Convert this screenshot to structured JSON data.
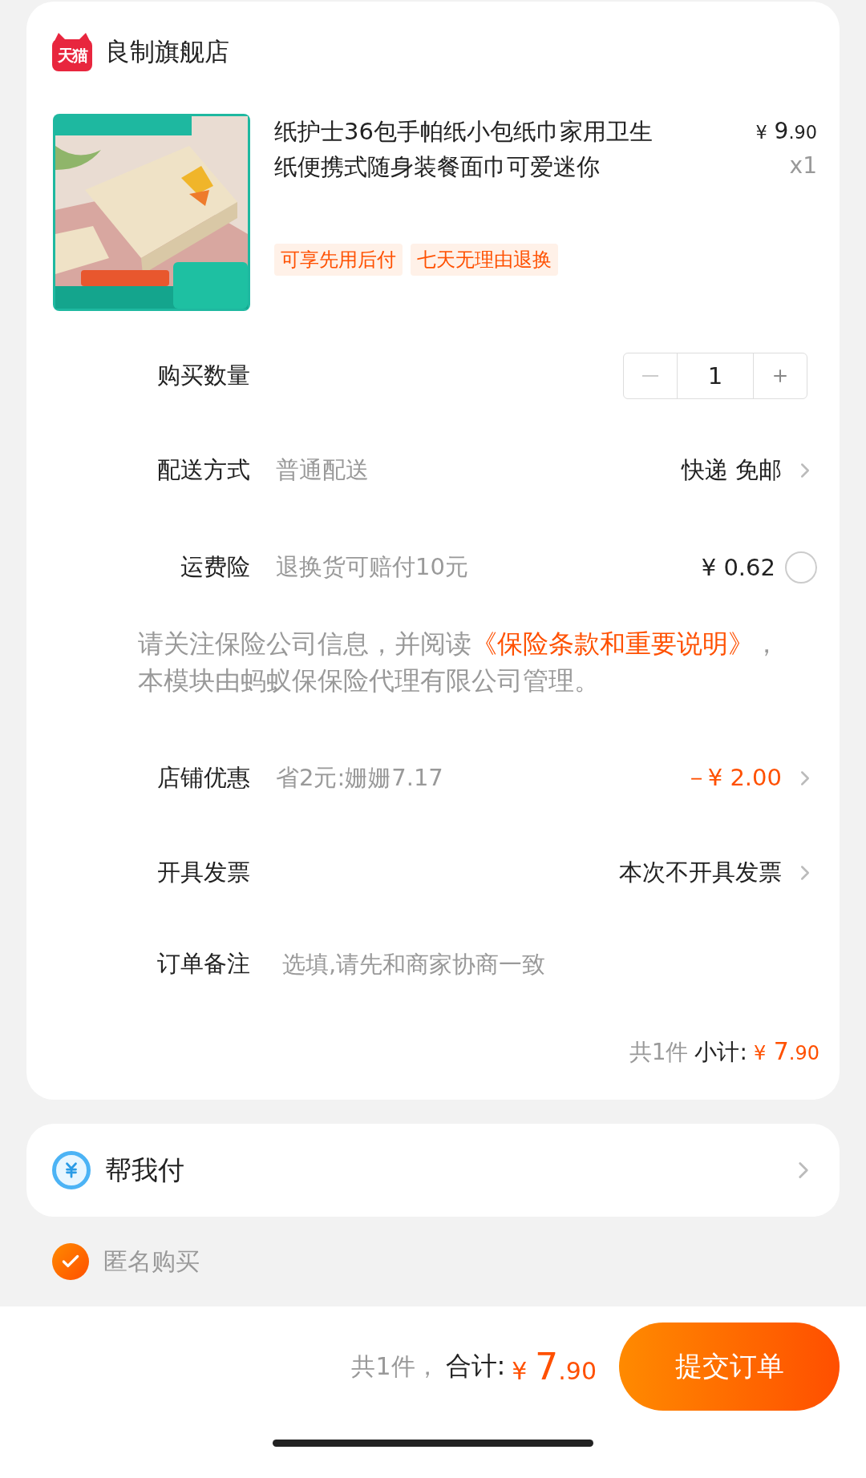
{
  "store": {
    "badge": "天猫",
    "name": "良制旗舰店"
  },
  "product": {
    "title": "纸护士36包手帕纸小包纸巾家用卫生纸便携式随身装餐面巾可爱迷你",
    "price": {
      "symbol": "¥",
      "int": "9",
      "dec": ".90"
    },
    "quantity": "x1",
    "tags": [
      "可享先用后付",
      "七天无理由退换"
    ]
  },
  "rows": [
    {
      "kind": "stepper",
      "label": "购买数量",
      "value": "1",
      "minus_disabled": true
    },
    {
      "kind": "link",
      "label": "配送方式",
      "detail": "普通配送",
      "value": "快递 免邮",
      "accent": false
    },
    {
      "kind": "check",
      "label": "运费险",
      "detail": "退换货可赔付10元",
      "value": "¥ 0.62",
      "checked": false
    },
    {
      "kind": "notice",
      "text": "请关注保险公司信息，并阅读",
      "link": "《保险条款和重要说明》",
      "after": "，本模块由蚂蚁保保险代理有限公司管理。"
    },
    {
      "kind": "link",
      "label": "店铺优惠",
      "detail": "省2元:姗姗7.17",
      "value": "－¥ 2.00",
      "accent": true
    },
    {
      "kind": "link",
      "label": "开具发票",
      "value": "本次不开具发票",
      "accent": false
    },
    {
      "kind": "input",
      "label": "订单备注",
      "placeholder": "选填,请先和商家协商一致"
    }
  ],
  "subtotal": {
    "count": "共1件",
    "label": "小计:",
    "symbol": "¥",
    "int": "7",
    "dec": ".90"
  },
  "helper": {
    "label": "帮我付"
  },
  "anonymous": {
    "label": "匿名购买",
    "checked": true
  },
  "footer": {
    "count": "共1件，",
    "label": "合计:",
    "symbol": "¥",
    "int": "7",
    "dec": ".90",
    "submit": "提交订单"
  }
}
